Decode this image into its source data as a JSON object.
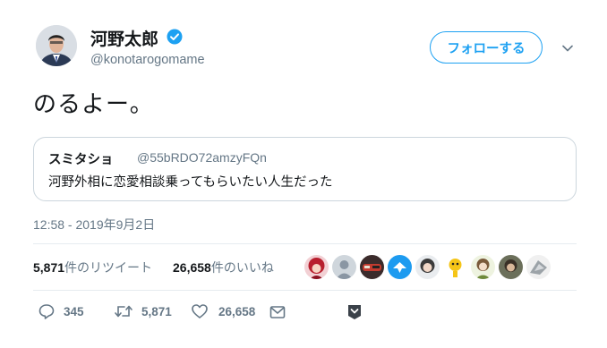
{
  "author": {
    "name": "河野太郎",
    "handle": "@konotarogomame",
    "follow_label": "フォローする"
  },
  "tweet": {
    "text": "のるよー。",
    "timestamp": "12:58 - 2019年9月2日"
  },
  "quoted": {
    "name": "スミタショ",
    "handle": "@55bRDO72amzyFQn",
    "text": "河野外相に恋愛相談乗ってもらいたい人生だった"
  },
  "stats": {
    "retweets_count": "5,871",
    "retweets_label": "件のリツイート",
    "likes_count": "26,658",
    "likes_label": "件のいいね"
  },
  "actions": {
    "reply_count": "345",
    "retweet_count": "5,871",
    "like_count": "26,658"
  },
  "colors": {
    "accent": "#1da1f2",
    "secondary_text": "#657786",
    "border": "#ccd6dd"
  }
}
